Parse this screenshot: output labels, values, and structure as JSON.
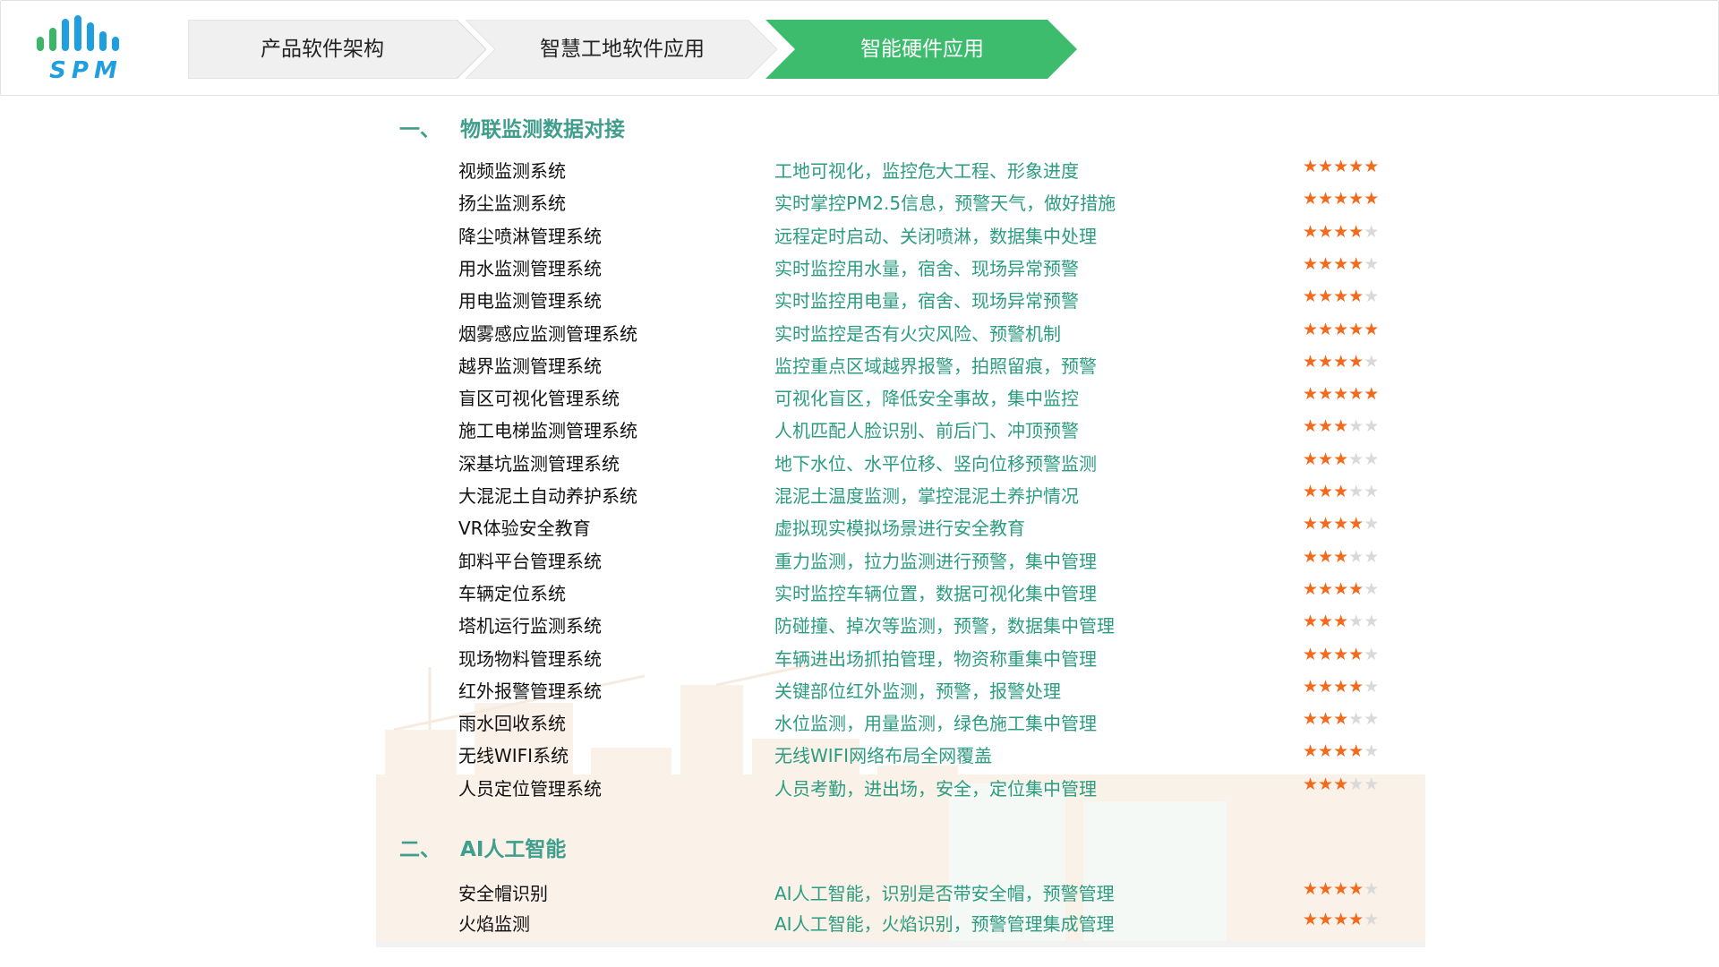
{
  "logo": {
    "text": "SPM",
    "accent": "#1f9fe0",
    "green": "#3ab56a"
  },
  "nav": {
    "items": [
      {
        "label": "产品软件架构",
        "active": false
      },
      {
        "label": "智慧工地软件应用",
        "active": false
      },
      {
        "label": "智能硬件应用",
        "active": true
      }
    ],
    "active_color": "#3cbc6c",
    "inactive_color": "#f0f0f0"
  },
  "sections": [
    {
      "number": "一、",
      "title": "物联监测数据对接",
      "rows": [
        {
          "name": "视频监测系统",
          "desc": "工地可视化，监控危大工程、形象进度",
          "rating": 5
        },
        {
          "name": "扬尘监测系统",
          "desc": "实时掌控PM2.5信息，预警天气，做好措施",
          "rating": 5
        },
        {
          "name": "降尘喷淋管理系统",
          "desc": "远程定时启动、关闭喷淋，数据集中处理",
          "rating": 4
        },
        {
          "name": "用水监测管理系统",
          "desc": "实时监控用水量，宿舍、现场异常预警",
          "rating": 4
        },
        {
          "name": "用电监测管理系统",
          "desc": "实时监控用电量，宿舍、现场异常预警",
          "rating": 4
        },
        {
          "name": "烟雾感应监测管理系统",
          "desc": "实时监控是否有火灾风险、预警机制",
          "rating": 5
        },
        {
          "name": "越界监测管理系统",
          "desc": "监控重点区域越界报警，拍照留痕，预警",
          "rating": 4
        },
        {
          "name": "盲区可视化管理系统",
          "desc": "可视化盲区，降低安全事故，集中监控",
          "rating": 5
        },
        {
          "name": "施工电梯监测管理系统",
          "desc": "人机匹配人脸识别、前后门、冲顶预警",
          "rating": 3
        },
        {
          "name": "深基坑监测管理系统",
          "desc": "地下水位、水平位移、竖向位移预警监测",
          "rating": 3
        },
        {
          "name": "大混泥土自动养护系统",
          "desc": "混泥土温度监测，掌控混泥土养护情况",
          "rating": 3
        },
        {
          "name": "VR体验安全教育",
          "desc": "虚拟现实模拟场景进行安全教育",
          "rating": 4
        },
        {
          "name": "卸料平台管理系统",
          "desc": "重力监测，拉力监测进行预警，集中管理",
          "rating": 3
        },
        {
          "name": "车辆定位系统",
          "desc": "实时监控车辆位置，数据可视化集中管理",
          "rating": 4
        },
        {
          "name": "塔机运行监测系统",
          "desc": "防碰撞、掉次等监测，预警，数据集中管理",
          "rating": 3
        },
        {
          "name": "现场物料管理系统",
          "desc": "车辆进出场抓拍管理，物资称重集中管理",
          "rating": 4
        },
        {
          "name": "红外报警管理系统",
          "desc": "关键部位红外监测，预警，报警处理",
          "rating": 4
        },
        {
          "name": "雨水回收系统",
          "desc": "水位监测，用量监测，绿色施工集中管理",
          "rating": 3
        },
        {
          "name": "无线WIFI系统",
          "desc": "无线WIFI网络布局全网覆盖",
          "rating": 4
        },
        {
          "name": "人员定位管理系统",
          "desc": "人员考勤，进出场，安全，定位集中管理",
          "rating": 3
        }
      ]
    },
    {
      "number": "二、",
      "title": "AI人工智能",
      "rows": [
        {
          "name": "安全帽识别",
          "desc": "AI人工智能，识别是否带安全帽，预警管理",
          "rating": 4
        },
        {
          "name": "火焰监测",
          "desc": "AI人工智能，火焰识别，预警管理集成管理",
          "rating": 4
        }
      ]
    }
  ],
  "colors": {
    "title": "#3f9e8c",
    "desc": "#2c9c80",
    "star_on": "#f26b1d",
    "star_off": "#d9d9d9"
  }
}
